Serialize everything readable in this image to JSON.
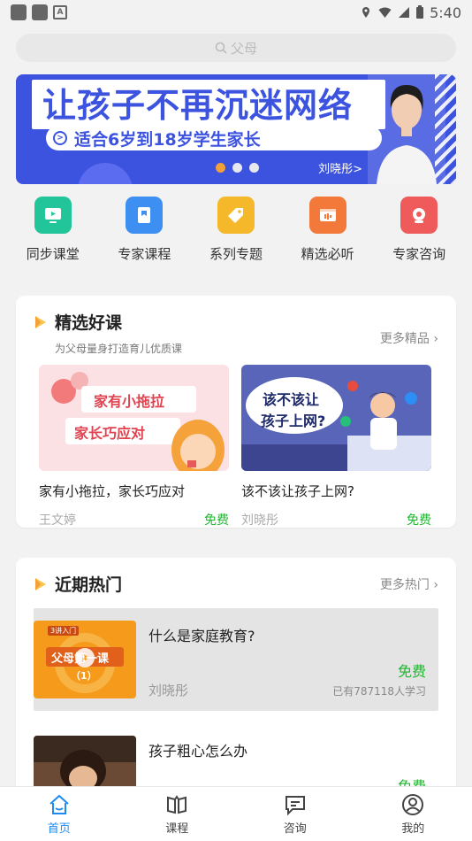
{
  "status": {
    "time": "5:40",
    "notif_letter": "A"
  },
  "search": {
    "placeholder": "父母"
  },
  "banner": {
    "title": "让孩子不再沉迷网络",
    "subtitle": "适合6岁到18岁学生家长",
    "person_name": "刘晓彤>",
    "dots": 3,
    "active_dot": 0
  },
  "quicknav": [
    {
      "label": "同步课堂",
      "icon": "tv-icon",
      "color": "#22c59a"
    },
    {
      "label": "专家课程",
      "icon": "bookmark-icon",
      "color": "#3d8ff2"
    },
    {
      "label": "系列专题",
      "icon": "tag-icon",
      "color": "#f5b82a"
    },
    {
      "label": "精选必听",
      "icon": "audio-icon",
      "color": "#f3793a"
    },
    {
      "label": "专家咨询",
      "icon": "camera-icon",
      "color": "#ef5b5b"
    }
  ],
  "featured": {
    "title": "精选好课",
    "subtitle": "为父母量身打造育儿优质课",
    "more": "更多精品",
    "courses": [
      {
        "name": "家有小拖拉，家长巧应对",
        "teacher": "王文婷",
        "price": "免费",
        "img_line1": "家有小拖拉",
        "img_line2": "家长巧应对"
      },
      {
        "name": "该不该让孩子上网?",
        "teacher": "刘晓彤",
        "price": "免费",
        "img_line1": "该不该让",
        "img_line2": "孩子上网?"
      }
    ]
  },
  "hot": {
    "title": "近期热门",
    "more": "更多热门",
    "items": [
      {
        "title": "什么是家庭教育?",
        "teacher": "刘晓彤",
        "price": "免费",
        "count": "已有787118人学习",
        "thumb_tag": "3讲入门",
        "thumb_line1": "父母第一课",
        "thumb_line2": "（1）"
      },
      {
        "title": "孩子粗心怎么办",
        "teacher": "",
        "price": "免费",
        "count": ""
      }
    ]
  },
  "tabbar": [
    {
      "label": "首页",
      "icon": "home-icon",
      "active": true
    },
    {
      "label": "课程",
      "icon": "book-icon",
      "active": false
    },
    {
      "label": "咨询",
      "icon": "chat-icon",
      "active": false
    },
    {
      "label": "我的",
      "icon": "user-icon",
      "active": false
    }
  ],
  "colors": {
    "accent": "#1f8bf0",
    "free": "#1cb82d",
    "banner": "#3c53e0"
  }
}
